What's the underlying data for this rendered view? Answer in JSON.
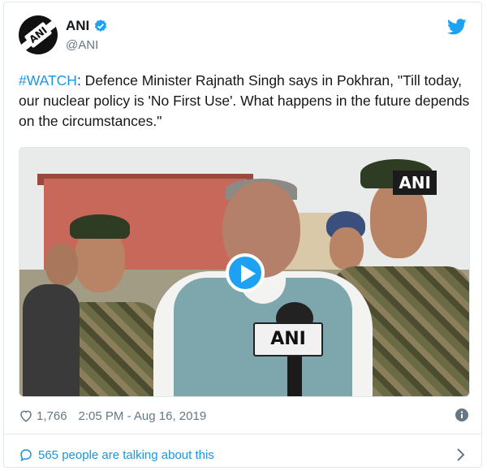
{
  "account": {
    "display_name": "ANI",
    "handle": "@ANI",
    "avatar_text": "ANI",
    "verified": true
  },
  "tweet": {
    "hashtag": "#WATCH",
    "text": ": Defence Minister Rajnath Singh says in Pokhran, \"Till today, our nuclear policy is 'No First Use'. What happens in the future depends on the circumstances.\""
  },
  "media": {
    "watermark": "ANI",
    "mic_label": "ANI"
  },
  "meta": {
    "likes": "1,766",
    "timestamp": "2:05 PM - Aug 16, 2019"
  },
  "footer": {
    "talking": "565 people are talking about this"
  },
  "colors": {
    "link": "#1b95e0",
    "twitter_blue": "#1da1f2",
    "secondary_text": "#657786"
  },
  "icons": {
    "verified": "verified-badge-icon",
    "brand": "twitter-bird-icon",
    "like": "heart-icon",
    "info": "info-icon",
    "reply": "reply-bubble-icon",
    "chevron": "chevron-right-icon",
    "play": "play-icon"
  }
}
